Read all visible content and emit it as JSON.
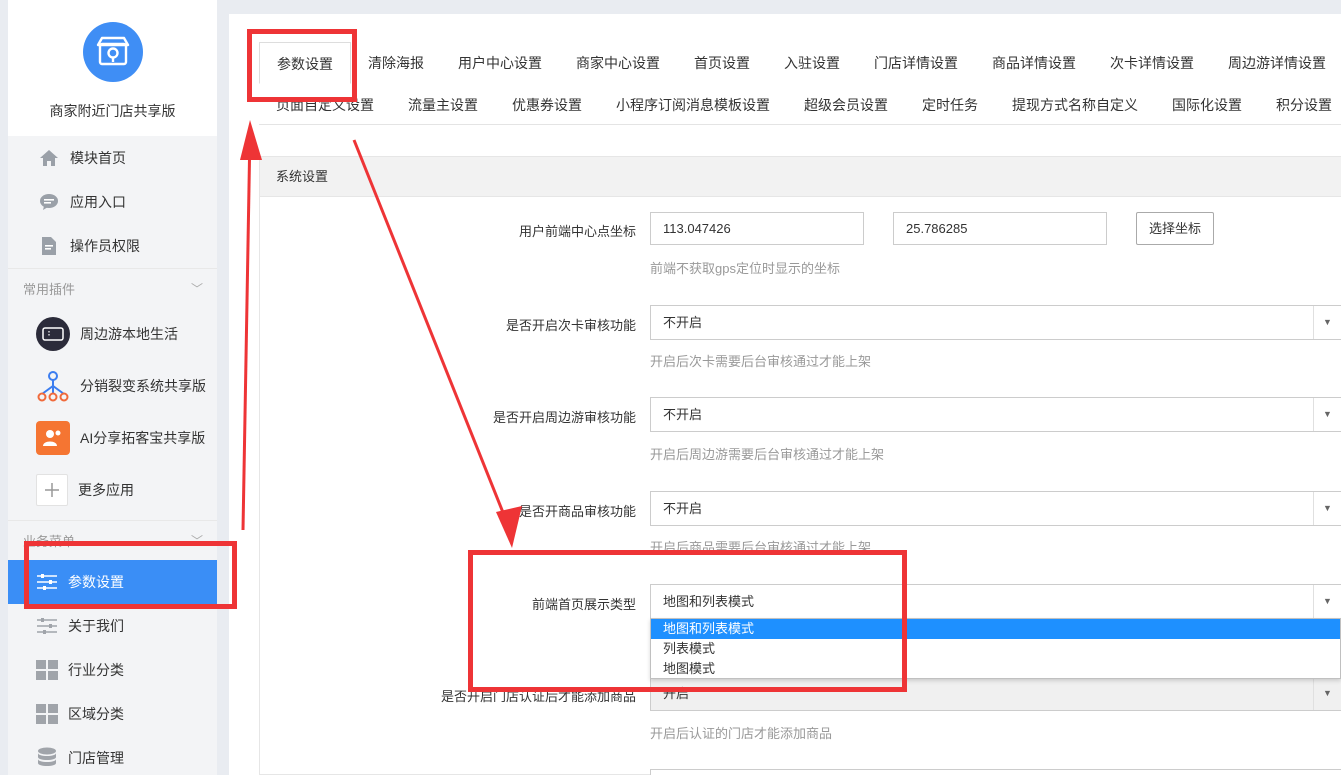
{
  "sidebar": {
    "app_name": "商家附近门店共享版",
    "main_nav": [
      {
        "label": "模块首页",
        "icon": "home-icon"
      },
      {
        "label": "应用入口",
        "icon": "chat-bubble-icon"
      },
      {
        "label": "操作员权限",
        "icon": "document-edit-icon"
      }
    ],
    "plugins_header": "常用插件",
    "plugins": [
      {
        "label": "周边游本地生活",
        "icon": "ticket-icon"
      },
      {
        "label": "分销裂变系统共享版",
        "icon": "network-tree-icon"
      },
      {
        "label": "AI分享拓客宝共享版",
        "icon": "ai-share-icon"
      },
      {
        "label": "更多应用",
        "icon": "plus-icon"
      }
    ],
    "business_header": "业务菜单",
    "business_nav": [
      {
        "label": "参数设置",
        "icon": "sliders-icon",
        "active": true
      },
      {
        "label": "关于我们",
        "icon": "sliders-icon"
      },
      {
        "label": "行业分类",
        "icon": "grid-icon"
      },
      {
        "label": "区域分类",
        "icon": "grid-icon"
      },
      {
        "label": "门店管理",
        "icon": "database-icon"
      }
    ]
  },
  "tabs": {
    "row1": [
      "参数设置",
      "清除海报",
      "用户中心设置",
      "商家中心设置",
      "首页设置",
      "入驻设置",
      "门店详情设置",
      "商品详情设置",
      "次卡详情设置",
      "周边游详情设置"
    ],
    "row2": [
      "页面自定义设置",
      "流量主设置",
      "优惠券设置",
      "小程序订阅消息模板设置",
      "超级会员设置",
      "定时任务",
      "提现方式名称自定义",
      "国际化设置",
      "积分设置"
    ]
  },
  "panel": {
    "title": "系统设置",
    "coord": {
      "label": "用户前端中心点坐标",
      "lng": "113.047426",
      "lat": "25.786285",
      "button": "选择坐标",
      "help": "前端不获取gps定位时显示的坐标"
    },
    "card_audit": {
      "label": "是否开启次卡审核功能",
      "value": "不开启",
      "help": "开启后次卡需要后台审核通过才能上架"
    },
    "tour_audit": {
      "label": "是否开启周边游审核功能",
      "value": "不开启",
      "help": "开启后周边游需要后台审核通过才能上架"
    },
    "goods_audit": {
      "label": "是否开商品审核功能",
      "value": "不开启",
      "help": "开启后商品需要后台审核通过才能上架"
    },
    "display_type": {
      "label": "前端首页展示类型",
      "value": "地图和列表模式",
      "options": [
        "地图和列表模式",
        "列表模式",
        "地图模式"
      ]
    },
    "store_cert": {
      "label": "是否开启门店认证后才能添加商品",
      "value": "开启",
      "help": "开启后认证的门店才能添加商品"
    }
  },
  "colors": {
    "accent": "#3a8ef6",
    "annotation": "#ee3436",
    "dropdown_selected": "#1e90ff"
  }
}
